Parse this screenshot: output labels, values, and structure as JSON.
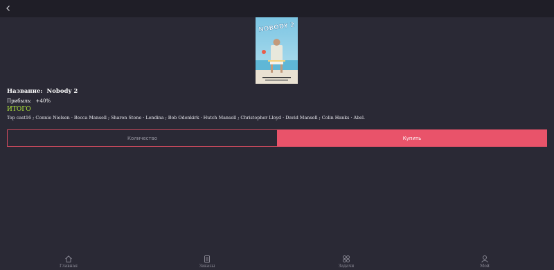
{
  "movie": {
    "title_label": "Название:",
    "title": "Nobody 2",
    "profit_label": "Прибыль:",
    "profit": "+40%",
    "total_label": "ИТОГО",
    "cast": "Top cast16 ; Connie Nielsen · Becca Mansell ; Sharon Stone · Lendina ; Bob Odenkirk · Hutch Mansell ; Christopher Lloyd · David Mansell ; Colin Hanks · Abel."
  },
  "poster": {
    "title_art": "NOBODY 2"
  },
  "actions": {
    "quantity_label": "Количество",
    "buy_label": "Купить"
  },
  "nav": [
    {
      "label": "Главная",
      "icon": "home-icon"
    },
    {
      "label": "Заказы",
      "icon": "orders-icon"
    },
    {
      "label": "Задачи",
      "icon": "tasks-icon"
    },
    {
      "label": "Мой",
      "icon": "profile-icon"
    }
  ],
  "colors": {
    "background": "#2a2935",
    "topbar": "#1f1e27",
    "accent": "#e9536a",
    "total": "#b8f03c"
  }
}
